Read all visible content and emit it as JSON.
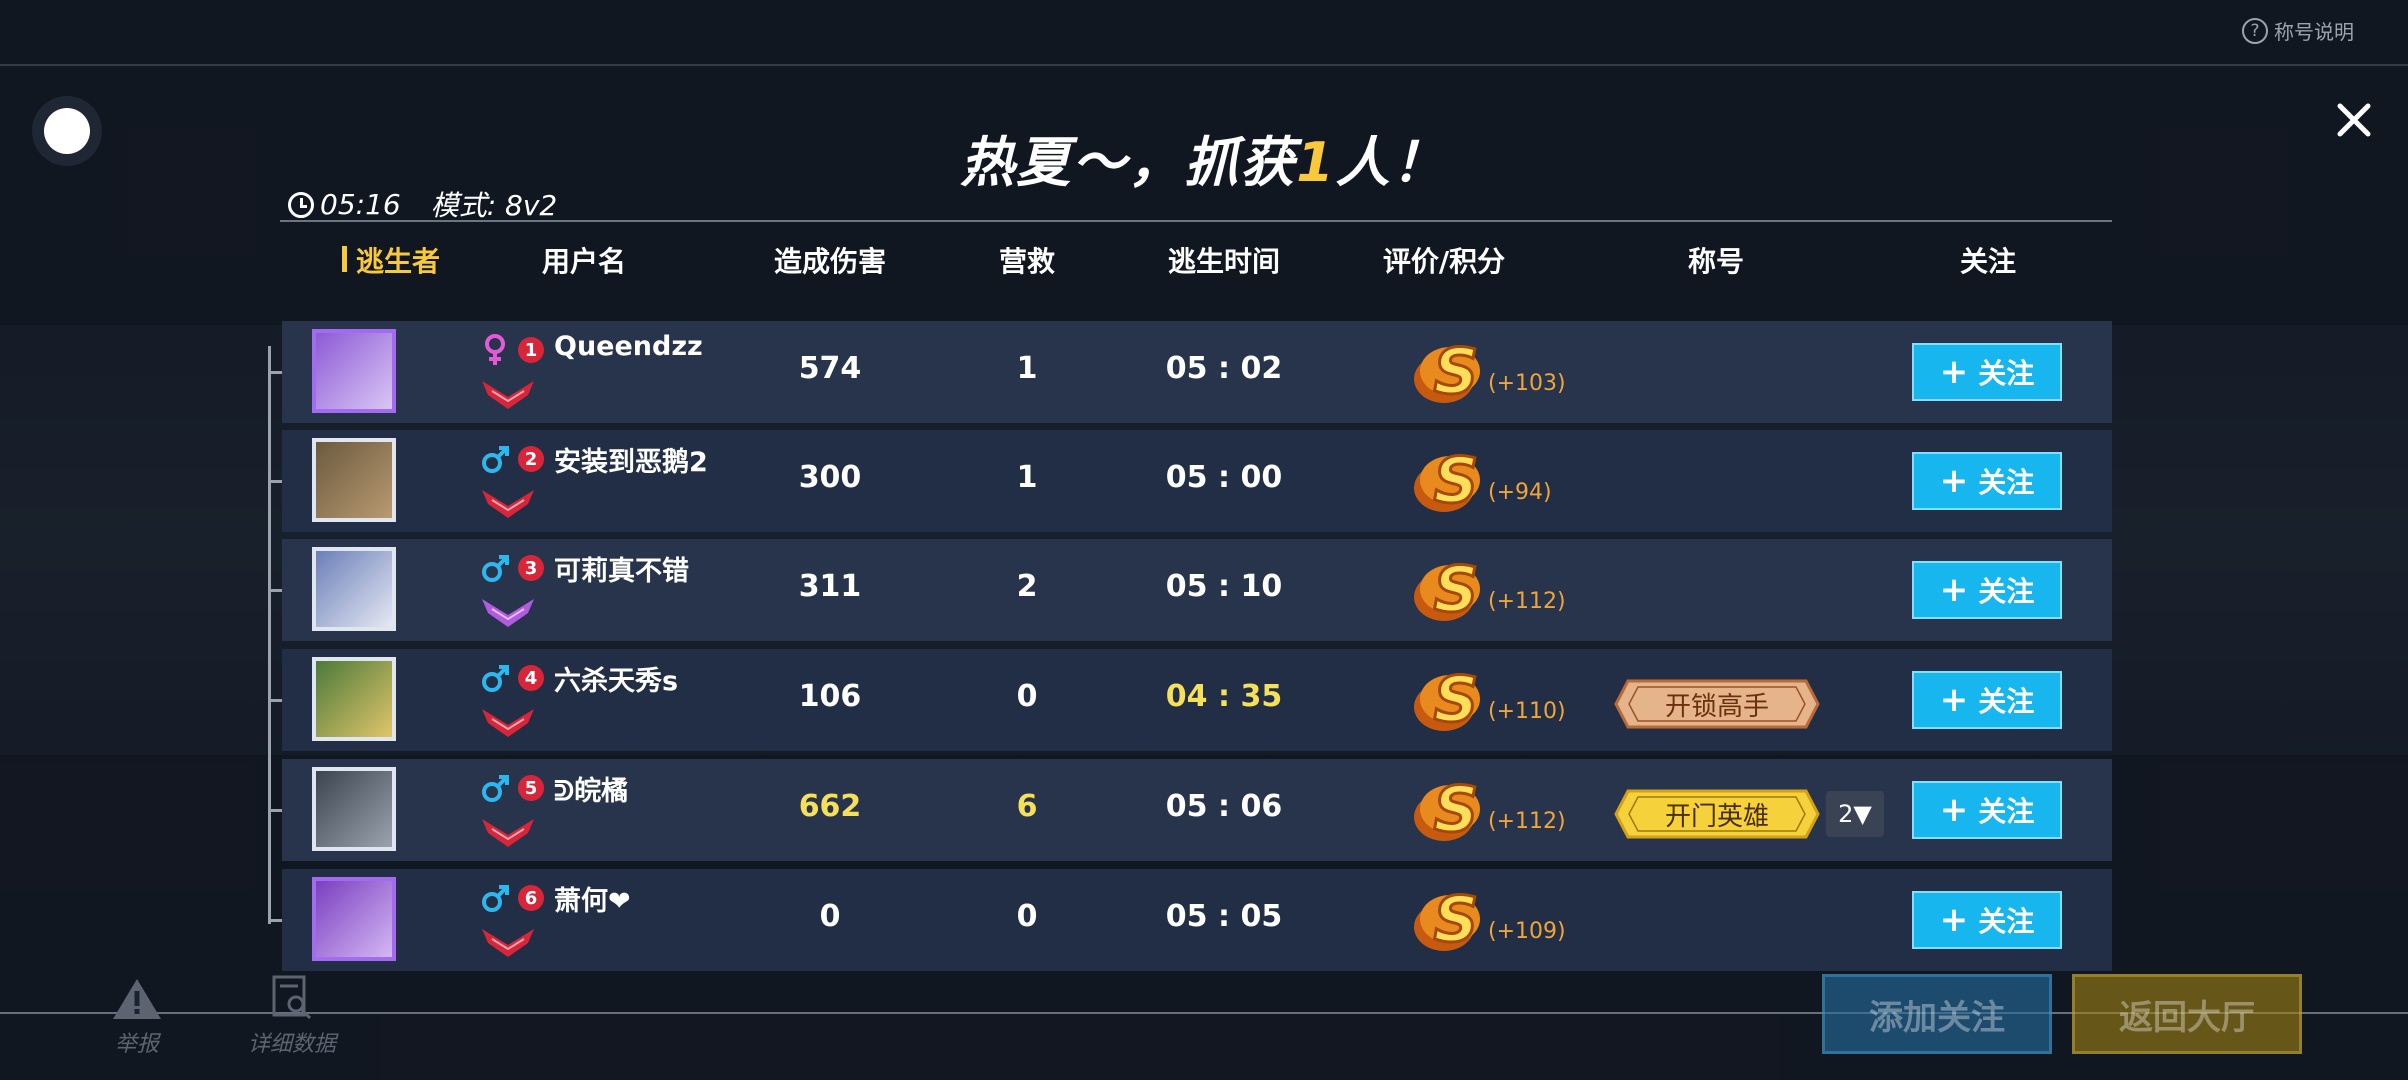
{
  "help": {
    "label": "称号说明"
  },
  "header_title": {
    "prefix": "热夏～，抓获",
    "count": "1",
    "suffix": "人！"
  },
  "match": {
    "time": "05:16",
    "mode": "模式: 8v2"
  },
  "columns": {
    "role": "逃生者",
    "username": "用户名",
    "damage": "造成伤害",
    "rescue": "营救",
    "escape_time": "逃生时间",
    "rating": "评价/积分",
    "title": "称号",
    "follow": "关注"
  },
  "players": [
    {
      "gender": "female",
      "rank": "1",
      "name": "Queendzz",
      "damage": "574",
      "rescue": "1",
      "time": "05 : 02",
      "grade": "S",
      "score": "(+103)",
      "title_tag": "",
      "follow_label": "关注",
      "highlight_damage": false,
      "highlight_rescue": false,
      "highlight_time": false
    },
    {
      "gender": "male",
      "rank": "2",
      "name": "安装到恶鹅2",
      "damage": "300",
      "rescue": "1",
      "time": "05 : 00",
      "grade": "S",
      "score": "(+94)",
      "title_tag": "",
      "follow_label": "关注",
      "highlight_damage": false,
      "highlight_rescue": false,
      "highlight_time": false
    },
    {
      "gender": "male",
      "rank": "3",
      "name": "可莉真不错",
      "damage": "311",
      "rescue": "2",
      "time": "05 : 10",
      "grade": "S",
      "score": "(+112)",
      "title_tag": "",
      "follow_label": "关注",
      "highlight_damage": false,
      "highlight_rescue": false,
      "highlight_time": false
    },
    {
      "gender": "male",
      "rank": "4",
      "name": "六杀天秀s",
      "damage": "106",
      "rescue": "0",
      "time": "04 : 35",
      "grade": "S",
      "score": "(+110)",
      "title_tag": "开锁高手",
      "follow_label": "关注",
      "highlight_damage": false,
      "highlight_rescue": false,
      "highlight_time": true
    },
    {
      "gender": "male",
      "rank": "5",
      "name": "ᕲ皖橘",
      "damage": "662",
      "rescue": "6",
      "time": "05 : 06",
      "grade": "S",
      "score": "(+112)",
      "title_tag": "开门英雄",
      "title_more": "2▼",
      "follow_label": "关注",
      "highlight_damage": true,
      "highlight_rescue": true,
      "highlight_time": false
    },
    {
      "gender": "male",
      "rank": "6",
      "name": "萧何❤",
      "damage": "0",
      "rescue": "0",
      "time": "05 : 05",
      "grade": "S",
      "score": "(+109)",
      "title_tag": "",
      "follow_label": "关注",
      "highlight_damage": false,
      "highlight_rescue": false,
      "highlight_time": false
    }
  ],
  "bottom": {
    "report": "举报",
    "details": "详细数据",
    "add_follow": "添加关注",
    "back": "返回大厅"
  },
  "colors": {
    "accent": "#f9c93b",
    "follow": "#17b6ee",
    "row": "#27344c"
  }
}
